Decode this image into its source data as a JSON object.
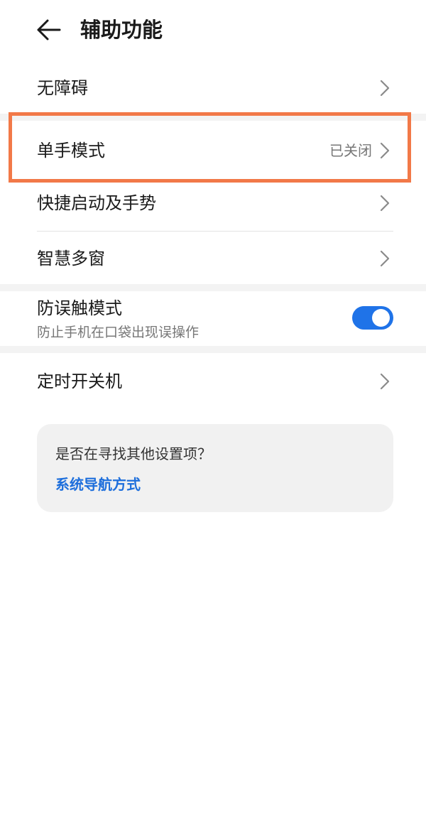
{
  "header": {
    "back_icon": "arrow-left-icon",
    "title": "辅助功能"
  },
  "settings": {
    "accessibility": {
      "label": "无障碍"
    },
    "one_hand_mode": {
      "label": "单手模式",
      "value": "已关闭"
    },
    "shortcuts_gestures": {
      "label": "快捷启动及手势"
    },
    "smart_multiwindow": {
      "label": "智慧多窗"
    },
    "accidental_touch": {
      "label": "防误触模式",
      "description": "防止手机在口袋出现误操作",
      "toggle_on": true
    },
    "scheduled_power": {
      "label": "定时开关机"
    }
  },
  "suggestion_card": {
    "question": "是否在寻找其他设置项？",
    "link_label": "系统导航方式"
  },
  "colors": {
    "accent": "#1f73e8",
    "link": "#1e6fdc",
    "highlight": "#f27948"
  }
}
